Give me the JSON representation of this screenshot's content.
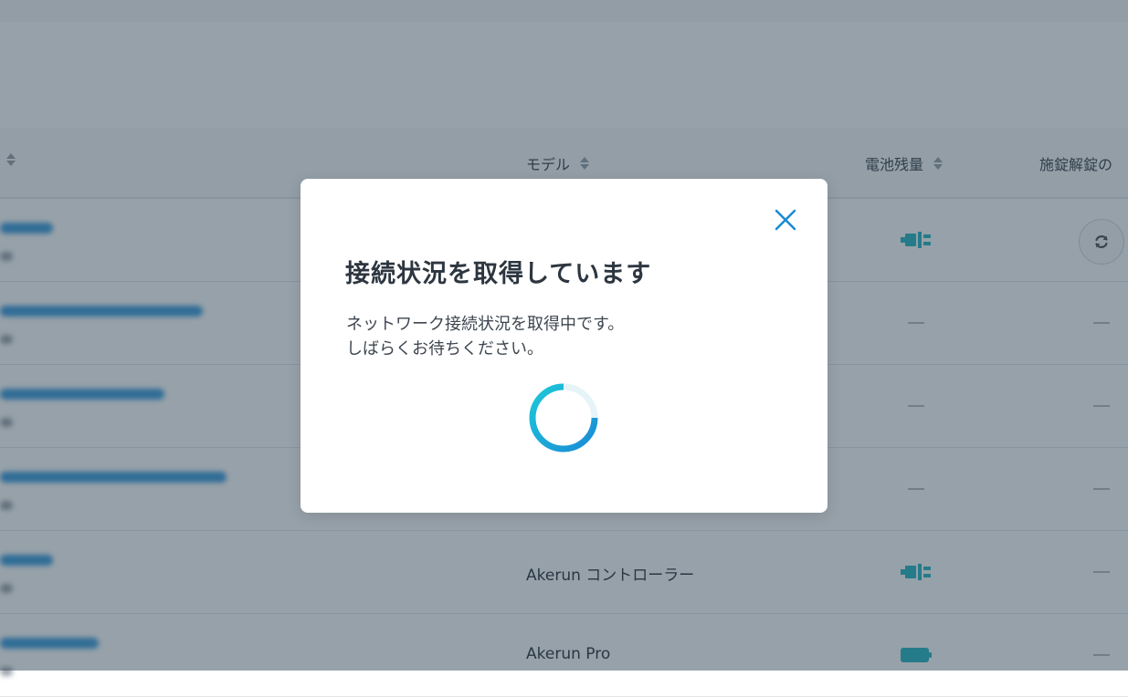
{
  "table": {
    "columns": {
      "model": "モデル",
      "battery": "電池残量",
      "lock_log": "施錠解錠の"
    },
    "rows": [
      {
        "model": "",
        "battery": "plug",
        "lock_action": "refresh"
      },
      {
        "model": "",
        "battery": "none",
        "lock_action": "none"
      },
      {
        "model": "",
        "battery": "none",
        "lock_action": "none"
      },
      {
        "model": "",
        "battery": "none",
        "lock_action": "none"
      },
      {
        "model": "Akerun コントローラー",
        "battery": "plug",
        "lock_action": "none"
      },
      {
        "model": "Akerun Pro",
        "battery": "full",
        "lock_action": "none"
      }
    ]
  },
  "modal": {
    "title": "接続状況を取得しています",
    "body_line1": "ネットワーク接続状況を取得中です。",
    "body_line2": "しばらくお待ちください。",
    "loading": true
  },
  "icons": {
    "close": "close-icon",
    "refresh": "refresh-icon",
    "plug": "plug-icon",
    "battery": "battery-icon",
    "sort": "sort-icon"
  },
  "colors": {
    "accent": "#1a8bd6",
    "spinner_start": "#1ec8d8",
    "spinner_end": "#1a8bd6",
    "battery": "#2bb8c4",
    "overlay": "#233748"
  }
}
